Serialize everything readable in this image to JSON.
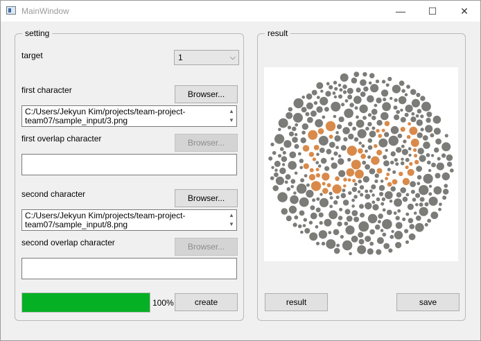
{
  "window": {
    "title": "MainWindow",
    "minimize": "—",
    "maximize": "☐",
    "close": "✕"
  },
  "setting": {
    "title": "setting",
    "target_label": "target",
    "target_value": "1",
    "first_character_label": "first character",
    "first_browse": "Browser...",
    "first_path_line1": "C:/Users/Jekyun Kim/projects/team-project-",
    "first_path_line2": "team07/sample_input/3.png",
    "first_overlap_label": "first overlap character",
    "first_overlap_browse": "Browser...",
    "first_overlap_value": "",
    "second_character_label": "second character",
    "second_browse": "Browser...",
    "second_path_line1": "C:/Users/Jekyun Kim/projects/team-project-",
    "second_path_line2": "team07/sample_input/8.png",
    "second_overlap_label": "second overlap character",
    "second_overlap_browse": "Browser...",
    "second_overlap_value": "",
    "progress_value": 1.0,
    "progress_text": "100%",
    "create_button": "create"
  },
  "result": {
    "title": "result",
    "image_icon": "color-blindness-plate",
    "colors": {
      "dot_gray": "#7b7b78",
      "dot_orange": "#d98a4a"
    },
    "result_button": "result",
    "save_button": "save"
  }
}
